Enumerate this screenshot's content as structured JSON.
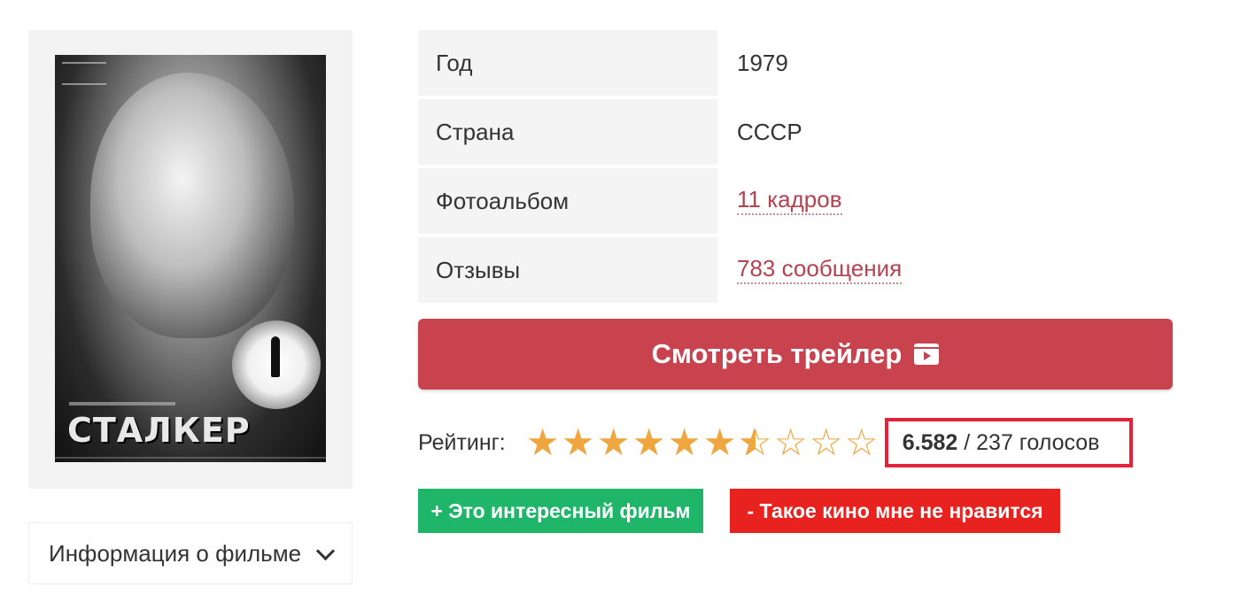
{
  "poster": {
    "title_text": "СТАЛКЕР"
  },
  "info_dropdown": {
    "label": "Информация о фильме"
  },
  "details": {
    "rows": [
      {
        "key": "Год",
        "value": "1979"
      },
      {
        "key": "Страна",
        "value": "СССР"
      },
      {
        "key": "Фотоальбом",
        "value": "11 кадров"
      },
      {
        "key": "Отзывы",
        "value": "783 сообщения"
      }
    ]
  },
  "trailer": {
    "label": "Смотреть трейлер",
    "icon": "play-video-icon"
  },
  "rating": {
    "label": "Рейтинг:",
    "score": "6.582",
    "separator": " / ",
    "votes": "237 голосов",
    "stars_total": 10,
    "stars_value": 6.582,
    "star_color": "#f0a63e",
    "highlight_color": "#e4223a"
  },
  "votes": {
    "like_label": "+ Это интересный фильм",
    "dislike_label": "- Такое кино мне не нравится",
    "like_color": "#1fb66a",
    "dislike_color": "#e8221e"
  },
  "colors": {
    "accent": "#c9434f",
    "link": "#b5424f"
  }
}
